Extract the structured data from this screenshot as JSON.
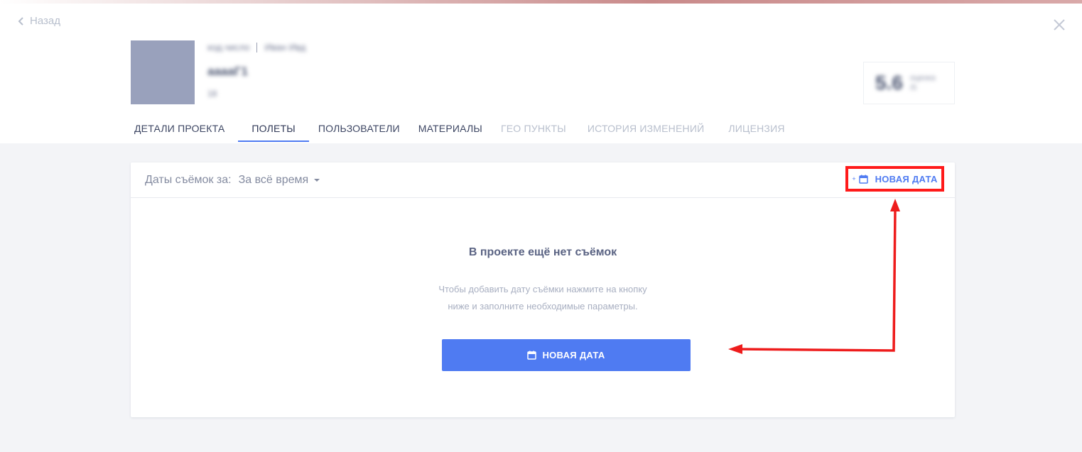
{
  "header": {
    "back_label": "Назад",
    "meta_left": "код.число",
    "meta_right": "Иван Ивд",
    "project_name": "ааааГ1",
    "project_sub": "18",
    "rating_value": "5.6",
    "rating_caption_1": "оценка",
    "rating_caption_2": "/5"
  },
  "tabs": [
    {
      "label": "ДЕТАЛИ ПРОЕКТА"
    },
    {
      "label": "ПОЛЕТЫ"
    },
    {
      "label": "ПОЛЬЗОВАТЕЛИ"
    },
    {
      "label": "МАТЕРИАЛЫ"
    },
    {
      "label": "ГЕО ПУНКТЫ"
    },
    {
      "label": "ИСТОРИЯ ИЗМЕНЕНИЙ"
    },
    {
      "label": "ЛИЦЕНЗИЯ"
    }
  ],
  "toolbar": {
    "filter_label": "Даты съёмок за:",
    "filter_value": "За всё время",
    "new_date_label": "НОВАЯ ДАТА",
    "new_date_plus": "+"
  },
  "empty_state": {
    "title": "В проекте ещё нет съёмок",
    "text_line_1": "Чтобы добавить дату съёмки нажмите на кнопку",
    "text_line_2": "ниже и заполните необходимые параметры.",
    "button_label": "НОВАЯ ДАТА"
  },
  "colors": {
    "accent": "#4f7bf2",
    "highlight": "#ff1a1a"
  },
  "icons": [
    "chevron-left-icon",
    "close-icon",
    "calendar-icon"
  ]
}
